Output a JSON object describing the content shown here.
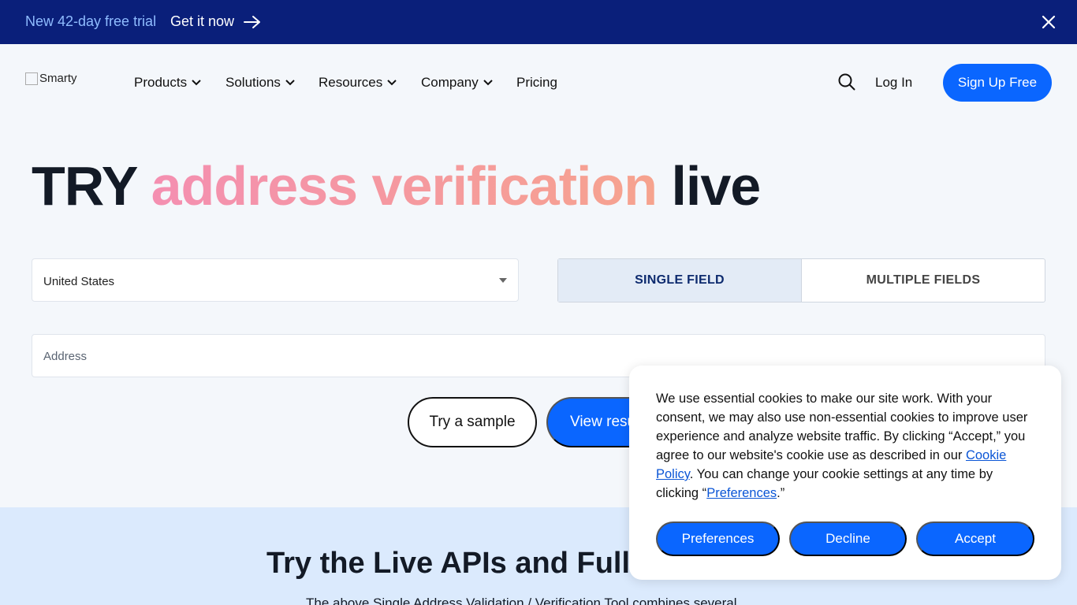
{
  "promo": {
    "trial_text": "New 42-day free trial",
    "cta_label": "Get it now"
  },
  "header": {
    "logo_alt": "Smarty",
    "nav": [
      {
        "label": "Products"
      },
      {
        "label": "Solutions"
      },
      {
        "label": "Resources"
      },
      {
        "label": "Company"
      },
      {
        "label": "Pricing"
      }
    ],
    "login_label": "Log In",
    "signup_label": "Sign Up Free"
  },
  "hero": {
    "title_prefix": "TRY",
    "title_highlight": "address verification",
    "title_suffix": "live"
  },
  "form": {
    "country_value": "United States",
    "toggle_single": "SINGLE FIELD",
    "toggle_multiple": "MULTIPLE FIELDS",
    "address_placeholder": "Address",
    "try_sample_label": "Try a sample",
    "view_results_label": "View results"
  },
  "section": {
    "title": "Try the Live APIs and Full V",
    "text": "The above Single Address Validation / Verification Tool combines several"
  },
  "cookie": {
    "text_1": "We use essential cookies to make our site work. With your consent, we may also use non-essential cookies to improve user experience and analyze website traffic. By clicking “Accept,” you agree to our website's cookie use as described in our ",
    "policy_link": "Cookie Policy",
    "text_2": ". You can change your cookie settings at any time by clicking “",
    "preferences_link": "Preferences",
    "text_3": ".”",
    "preferences_button": "Preferences",
    "decline_button": "Decline",
    "accept_button": "Accept"
  },
  "colors": {
    "promo_bg": "#0a1f7a",
    "primary": "#0a66ff",
    "highlight_gradient_start": "#f48fb1",
    "highlight_gradient_end": "#f6a38e"
  }
}
